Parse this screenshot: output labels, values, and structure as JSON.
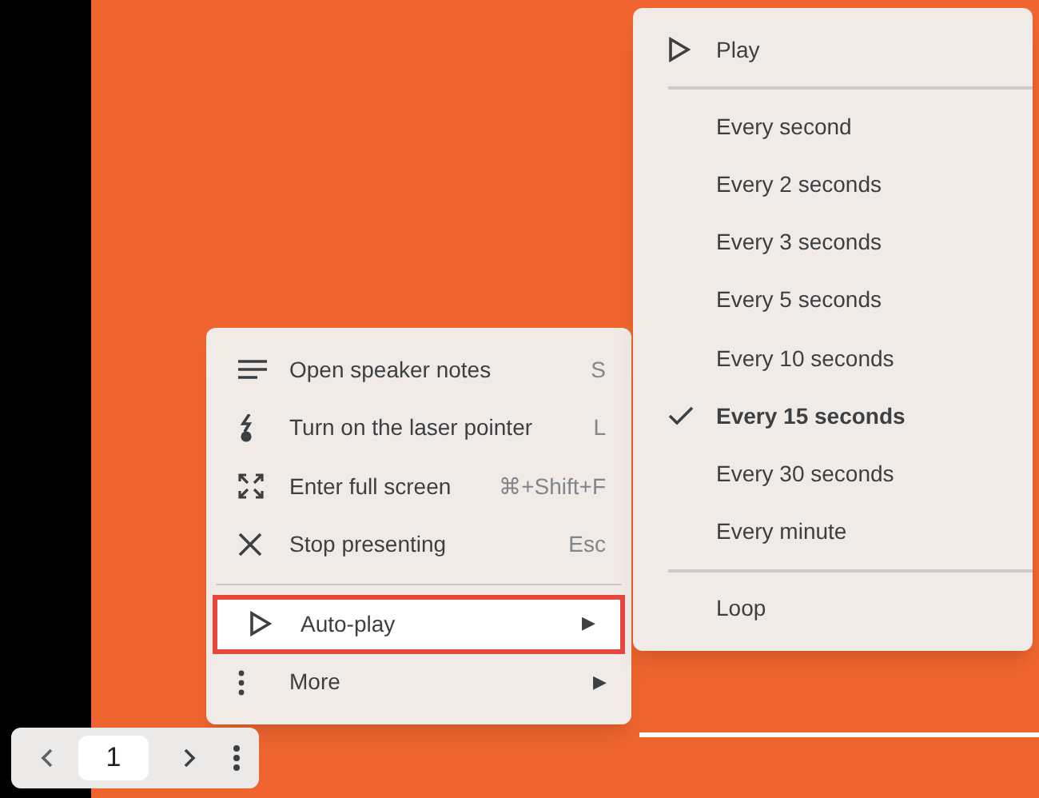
{
  "menu": {
    "items": [
      {
        "kind": "action",
        "label": "Open speaker notes",
        "shortcut": "S",
        "highlighted": false
      },
      {
        "kind": "action",
        "label": "Turn on the laser pointer",
        "shortcut": "L",
        "highlighted": false
      },
      {
        "kind": "action",
        "label": "Enter full screen",
        "shortcut": "⌘+Shift+F",
        "highlighted": false
      },
      {
        "kind": "action",
        "label": "Stop presenting",
        "shortcut": "Esc",
        "highlighted": false
      },
      {
        "kind": "divider"
      },
      {
        "kind": "submenu",
        "label": "Auto-play",
        "arrow": "▶",
        "highlighted": true
      },
      {
        "kind": "submenu",
        "label": "More",
        "arrow": "▶",
        "highlighted": false
      }
    ]
  },
  "submenu": {
    "items": [
      {
        "kind": "play",
        "label": "Play"
      },
      {
        "kind": "divider"
      },
      {
        "kind": "option",
        "label": "Every second",
        "selected": false
      },
      {
        "kind": "option",
        "label": "Every 2 seconds",
        "selected": false
      },
      {
        "kind": "option",
        "label": "Every 3 seconds",
        "selected": false
      },
      {
        "kind": "option",
        "label": "Every 5 seconds",
        "selected": false
      },
      {
        "kind": "option",
        "label": "Every 10 seconds",
        "selected": false
      },
      {
        "kind": "option",
        "label": "Every 15 seconds",
        "selected": true
      },
      {
        "kind": "option",
        "label": "Every 30 seconds",
        "selected": false
      },
      {
        "kind": "option",
        "label": "Every minute",
        "selected": false
      },
      {
        "kind": "divider"
      },
      {
        "kind": "toggle",
        "label": "Loop",
        "checked": false
      }
    ]
  },
  "pager": {
    "page": "1"
  }
}
